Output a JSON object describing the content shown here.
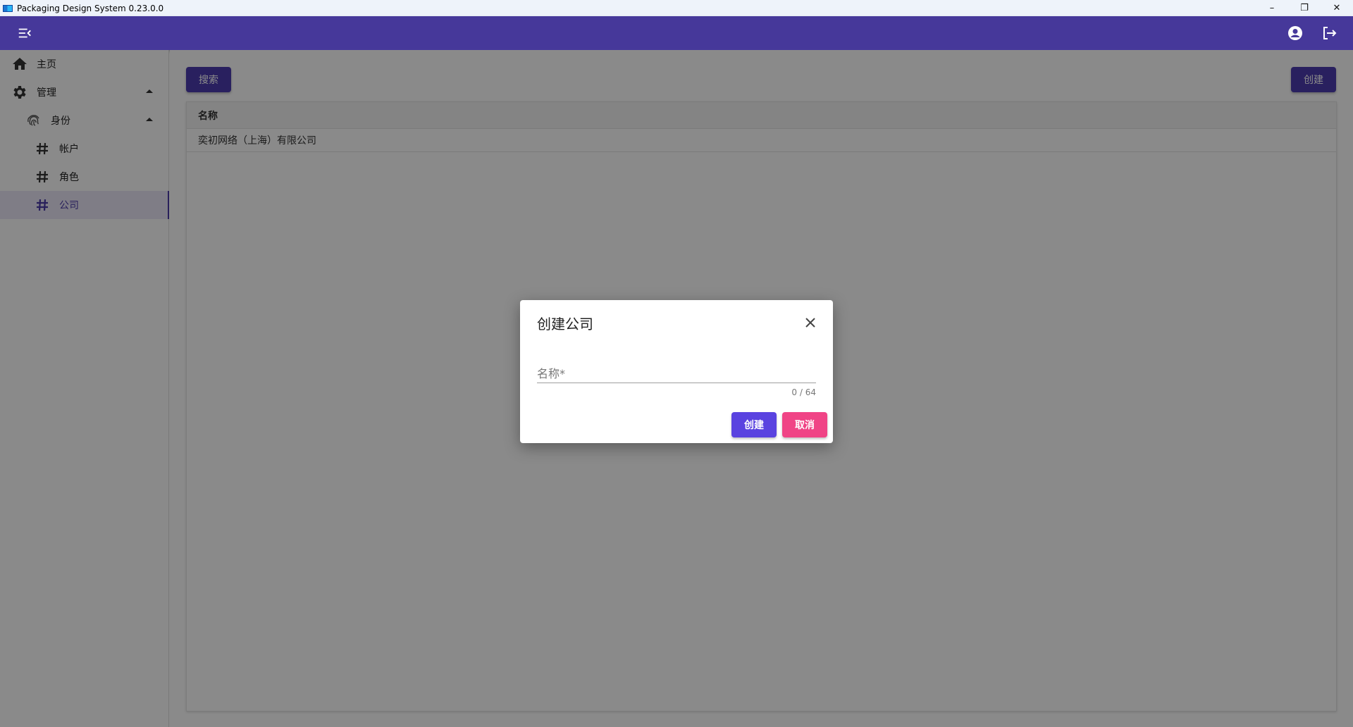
{
  "window": {
    "title": "Packaging Design System 0.23.0.0",
    "controls": {
      "minimize": "–",
      "restore": "❐",
      "close": "✕"
    }
  },
  "appbar": {
    "menu_icon": "menu-collapse-icon",
    "account_icon": "account-circle-icon",
    "logout_icon": "logout-icon",
    "color": "#46389a"
  },
  "sidebar": {
    "items": [
      {
        "label": "主页",
        "icon": "home-icon"
      },
      {
        "label": "管理",
        "icon": "gear-icon",
        "expanded": true
      },
      {
        "label": "身份",
        "icon": "fingerprint-icon",
        "expanded": true
      },
      {
        "label": "帐户",
        "icon": "hash-icon"
      },
      {
        "label": "角色",
        "icon": "hash-icon"
      },
      {
        "label": "公司",
        "icon": "hash-icon",
        "active": true
      }
    ]
  },
  "toolbar": {
    "search_label": "搜索",
    "create_label": "创建"
  },
  "table": {
    "columns": [
      "名称"
    ],
    "rows": [
      [
        "奕初网络（上海）有限公司"
      ]
    ]
  },
  "dialog": {
    "title": "创建公司",
    "name_field": {
      "placeholder": "名称*",
      "value": "",
      "counter": "0 / 64"
    },
    "create_label": "创建",
    "cancel_label": "取消"
  },
  "colors": {
    "primary": "#4c3bb0",
    "create": "#5a43e0",
    "cancel": "#f04486"
  }
}
